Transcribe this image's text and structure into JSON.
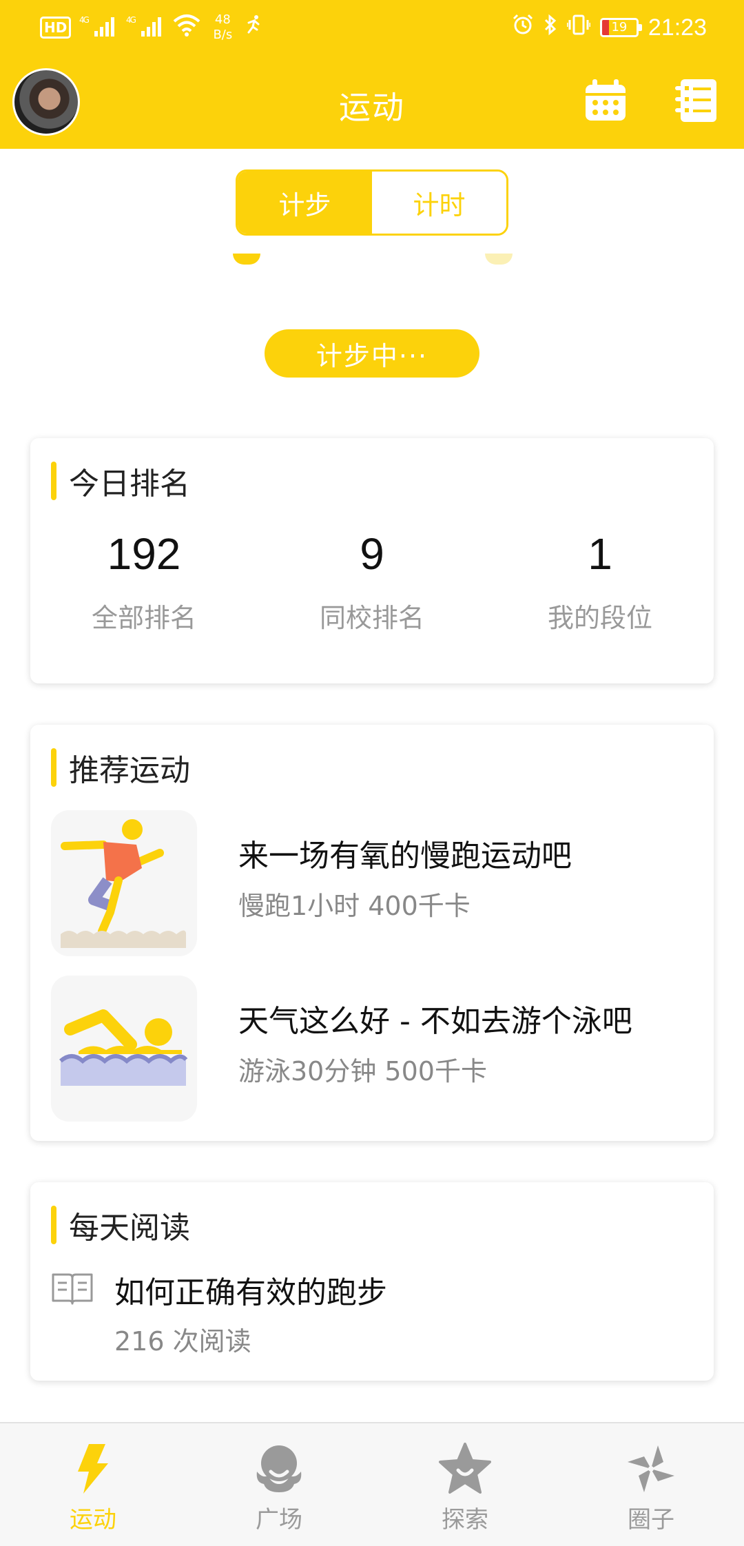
{
  "status_bar": {
    "left_badge": "HD",
    "signal_1": "4G",
    "signal_2": "4G",
    "net_speed_value": "48",
    "net_speed_unit": "B/s",
    "battery_level": "19",
    "time": "21:23"
  },
  "header": {
    "title": "运动",
    "calendar_icon": "calendar-icon",
    "list_icon": "list-icon"
  },
  "mode_tabs": [
    {
      "label": "计步",
      "active": true
    },
    {
      "label": "计时",
      "active": false
    }
  ],
  "counting_button": "计步中···",
  "today_ranking": {
    "title": "今日排名",
    "items": [
      {
        "value": "192",
        "label": "全部排名"
      },
      {
        "value": "9",
        "label": "同校排名"
      },
      {
        "value": "1",
        "label": "我的段位"
      }
    ]
  },
  "recommended": {
    "title": "推荐运动",
    "items": [
      {
        "title": "来一场有氧的慢跑运动吧",
        "subtitle": "慢跑1小时 400千卡",
        "icon": "runner-icon"
      },
      {
        "title": "天气这么好 - 不如去游个泳吧",
        "subtitle": "游泳30分钟 500千卡",
        "icon": "swimmer-icon"
      }
    ]
  },
  "daily_reading": {
    "title": "每天阅读",
    "article_title": "如何正确有效的跑步",
    "read_count": "216 次阅读",
    "icon": "book-icon"
  },
  "bottom_nav": [
    {
      "label": "运动",
      "icon": "lightning-icon",
      "active": true
    },
    {
      "label": "广场",
      "icon": "plaza-icon",
      "active": false
    },
    {
      "label": "探索",
      "icon": "star-icon",
      "active": false
    },
    {
      "label": "圈子",
      "icon": "pinwheel-icon",
      "active": false
    }
  ],
  "colors": {
    "accent": "#FCD20B",
    "text_primary": "#111111",
    "text_secondary": "#888888"
  }
}
